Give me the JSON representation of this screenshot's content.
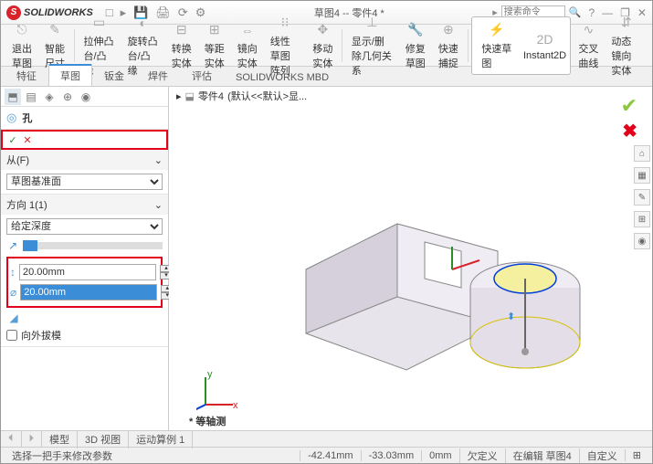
{
  "title": {
    "app": "SOLIDWORKS",
    "doc": "草图4 -- 零件4 *",
    "search_placeholder": "搜索命令"
  },
  "qat": {
    "new": "□",
    "open": "▸",
    "save": "💾",
    "print": "🖨",
    "refresh": "⟳",
    "settings": "⚙"
  },
  "win": {
    "help": "?",
    "min": "—",
    "max": "❐",
    "close": "✕"
  },
  "ribbon": {
    "exit": "退出草图",
    "smart": "智能尺寸",
    "g1": "拉伸凸台/凸缘",
    "g2": "旋转凸台/凸缘",
    "g3": "转换实体",
    "g4": "等距实体",
    "g5": "镜向实体",
    "g6": "线性草图阵列",
    "g7": "移动实体",
    "d1": "显示/删除几何关系",
    "d2": "修复草图",
    "d3": "快速捕捉",
    "q1": "快速草图",
    "q2": "Instant2D",
    "q3": "交叉曲线",
    "q4": "动态镜向实体"
  },
  "tabs": {
    "t1": "特征",
    "t2": "草图",
    "t3": "钣金",
    "t4": "焊件",
    "t5": "评估",
    "t6": "SOLIDWORKS MBD"
  },
  "pm": {
    "title": "孔",
    "ok": "✓",
    "cancel": "✕",
    "from_label": "从(F)",
    "from_value": "草图基准面",
    "dir_label": "方向 1(1)",
    "dir_value": "给定深度",
    "depth": "20.00mm",
    "diameter": "20.00mm",
    "draft_label": "向外拔模"
  },
  "crumb": {
    "part": "零件4",
    "state": "(默认<<默认>显..."
  },
  "bottomtabs": {
    "b1": "模型",
    "b2": "3D 视图",
    "b3": "运动算例 1"
  },
  "status": {
    "msg": "选择一把手来修改参数",
    "x": "-42.41mm",
    "y": "-33.03mm",
    "z": "0mm",
    "def": "欠定义",
    "edit": "在编辑 草图4",
    "custom": "自定义"
  },
  "axis_label": "* 等轴测"
}
